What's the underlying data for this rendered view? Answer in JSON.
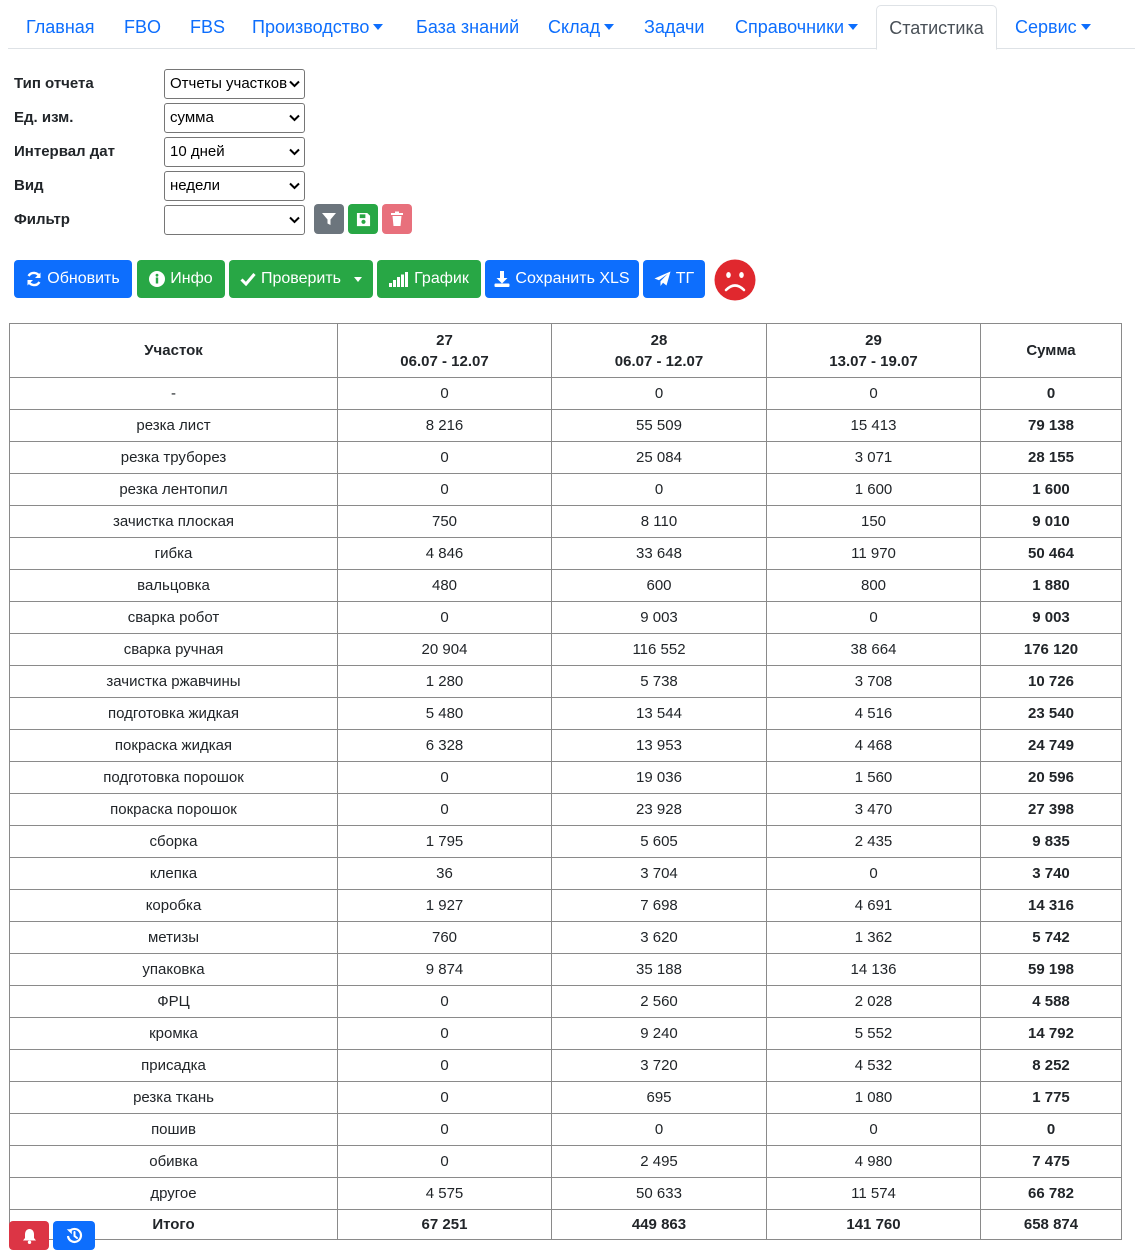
{
  "nav": {
    "items": [
      {
        "label": "Главная",
        "dropdown": false
      },
      {
        "label": "FBO",
        "dropdown": false
      },
      {
        "label": "FBS",
        "dropdown": false
      },
      {
        "label": "Производство",
        "dropdown": true
      },
      {
        "label": "База знаний",
        "dropdown": false
      },
      {
        "label": "Склад",
        "dropdown": true
      },
      {
        "label": "Задачи",
        "dropdown": false
      },
      {
        "label": "Справочники",
        "dropdown": true
      },
      {
        "label": "Статистика",
        "dropdown": false,
        "active": true
      },
      {
        "label": "Сервис",
        "dropdown": true
      }
    ]
  },
  "form": {
    "report_type": {
      "label": "Тип отчета",
      "value": "Отчеты участков"
    },
    "unit": {
      "label": "Ед. изм.",
      "value": "сумма"
    },
    "interval": {
      "label": "Интервал дат",
      "value": "10 дней"
    },
    "view": {
      "label": "Вид",
      "value": "недели"
    },
    "filter": {
      "label": "Фильтр",
      "value": ""
    }
  },
  "actions": {
    "refresh": "Обновить",
    "info": "Инфо",
    "check": "Проверить",
    "chart": "График",
    "save_xls": "Сохранить XLS",
    "tg": "ТГ"
  },
  "table": {
    "header": {
      "section": "Участок",
      "columns": [
        {
          "week": "27",
          "range": "06.07 - 12.07"
        },
        {
          "week": "28",
          "range": "06.07 - 12.07"
        },
        {
          "week": "29",
          "range": "13.07 - 19.07"
        }
      ],
      "sum": "Сумма"
    },
    "rows": [
      {
        "name": "-",
        "values": [
          "0",
          "0",
          "0"
        ],
        "sum": "0"
      },
      {
        "name": "резка лист",
        "values": [
          "8 216",
          "55 509",
          "15 413"
        ],
        "sum": "79 138"
      },
      {
        "name": "резка труборез",
        "values": [
          "0",
          "25 084",
          "3 071"
        ],
        "sum": "28 155"
      },
      {
        "name": "резка лентопил",
        "values": [
          "0",
          "0",
          "1 600"
        ],
        "sum": "1 600"
      },
      {
        "name": "зачистка плоская",
        "values": [
          "750",
          "8 110",
          "150"
        ],
        "sum": "9 010"
      },
      {
        "name": "гибка",
        "values": [
          "4 846",
          "33 648",
          "11 970"
        ],
        "sum": "50 464"
      },
      {
        "name": "вальцовка",
        "values": [
          "480",
          "600",
          "800"
        ],
        "sum": "1 880"
      },
      {
        "name": "сварка робот",
        "values": [
          "0",
          "9 003",
          "0"
        ],
        "sum": "9 003"
      },
      {
        "name": "сварка ручная",
        "values": [
          "20 904",
          "116 552",
          "38 664"
        ],
        "sum": "176 120"
      },
      {
        "name": "зачистка ржавчины",
        "values": [
          "1 280",
          "5 738",
          "3 708"
        ],
        "sum": "10 726"
      },
      {
        "name": "подготовка жидкая",
        "values": [
          "5 480",
          "13 544",
          "4 516"
        ],
        "sum": "23 540"
      },
      {
        "name": "покраска жидкая",
        "values": [
          "6 328",
          "13 953",
          "4 468"
        ],
        "sum": "24 749"
      },
      {
        "name": "подготовка порошок",
        "values": [
          "0",
          "19 036",
          "1 560"
        ],
        "sum": "20 596"
      },
      {
        "name": "покраска порошок",
        "values": [
          "0",
          "23 928",
          "3 470"
        ],
        "sum": "27 398"
      },
      {
        "name": "сборка",
        "values": [
          "1 795",
          "5 605",
          "2 435"
        ],
        "sum": "9 835"
      },
      {
        "name": "клепка",
        "values": [
          "36",
          "3 704",
          "0"
        ],
        "sum": "3 740"
      },
      {
        "name": "коробка",
        "values": [
          "1 927",
          "7 698",
          "4 691"
        ],
        "sum": "14 316"
      },
      {
        "name": "метизы",
        "values": [
          "760",
          "3 620",
          "1 362"
        ],
        "sum": "5 742"
      },
      {
        "name": "упаковка",
        "values": [
          "9 874",
          "35 188",
          "14 136"
        ],
        "sum": "59 198"
      },
      {
        "name": "ФРЦ",
        "values": [
          "0",
          "2 560",
          "2 028"
        ],
        "sum": "4 588"
      },
      {
        "name": "кромка",
        "values": [
          "0",
          "9 240",
          "5 552"
        ],
        "sum": "14 792"
      },
      {
        "name": "присадка",
        "values": [
          "0",
          "3 720",
          "4 532"
        ],
        "sum": "8 252"
      },
      {
        "name": "резка ткань",
        "values": [
          "0",
          "695",
          "1 080"
        ],
        "sum": "1 775"
      },
      {
        "name": "пошив",
        "values": [
          "0",
          "0",
          "0"
        ],
        "sum": "0"
      },
      {
        "name": "обивка",
        "values": [
          "0",
          "2 495",
          "4 980"
        ],
        "sum": "7 475"
      },
      {
        "name": "другое",
        "values": [
          "4 575",
          "50 633",
          "11 574"
        ],
        "sum": "66 782"
      }
    ],
    "total": {
      "name": "Итого",
      "values": [
        "67 251",
        "449 863",
        "141 760"
      ],
      "sum": "658 874"
    }
  },
  "colors": {
    "primary": "#0d6efd",
    "success": "#28a745",
    "secondary": "#6c757d",
    "danger": "#dc3545",
    "danger_light": "#e8707c",
    "status_sad": "#e0282e"
  },
  "icons": {
    "refresh": "sync-icon",
    "info": "info-circle-icon",
    "check": "check-icon",
    "chart": "signal-bars-icon",
    "save_xls": "download-icon",
    "tg": "paper-plane-icon",
    "status": "sad-face-icon",
    "filter": "funnel-icon",
    "save_filter": "floppy-disk-icon",
    "delete_filter": "trash-icon",
    "bell": "bell-icon",
    "history": "history-icon"
  }
}
